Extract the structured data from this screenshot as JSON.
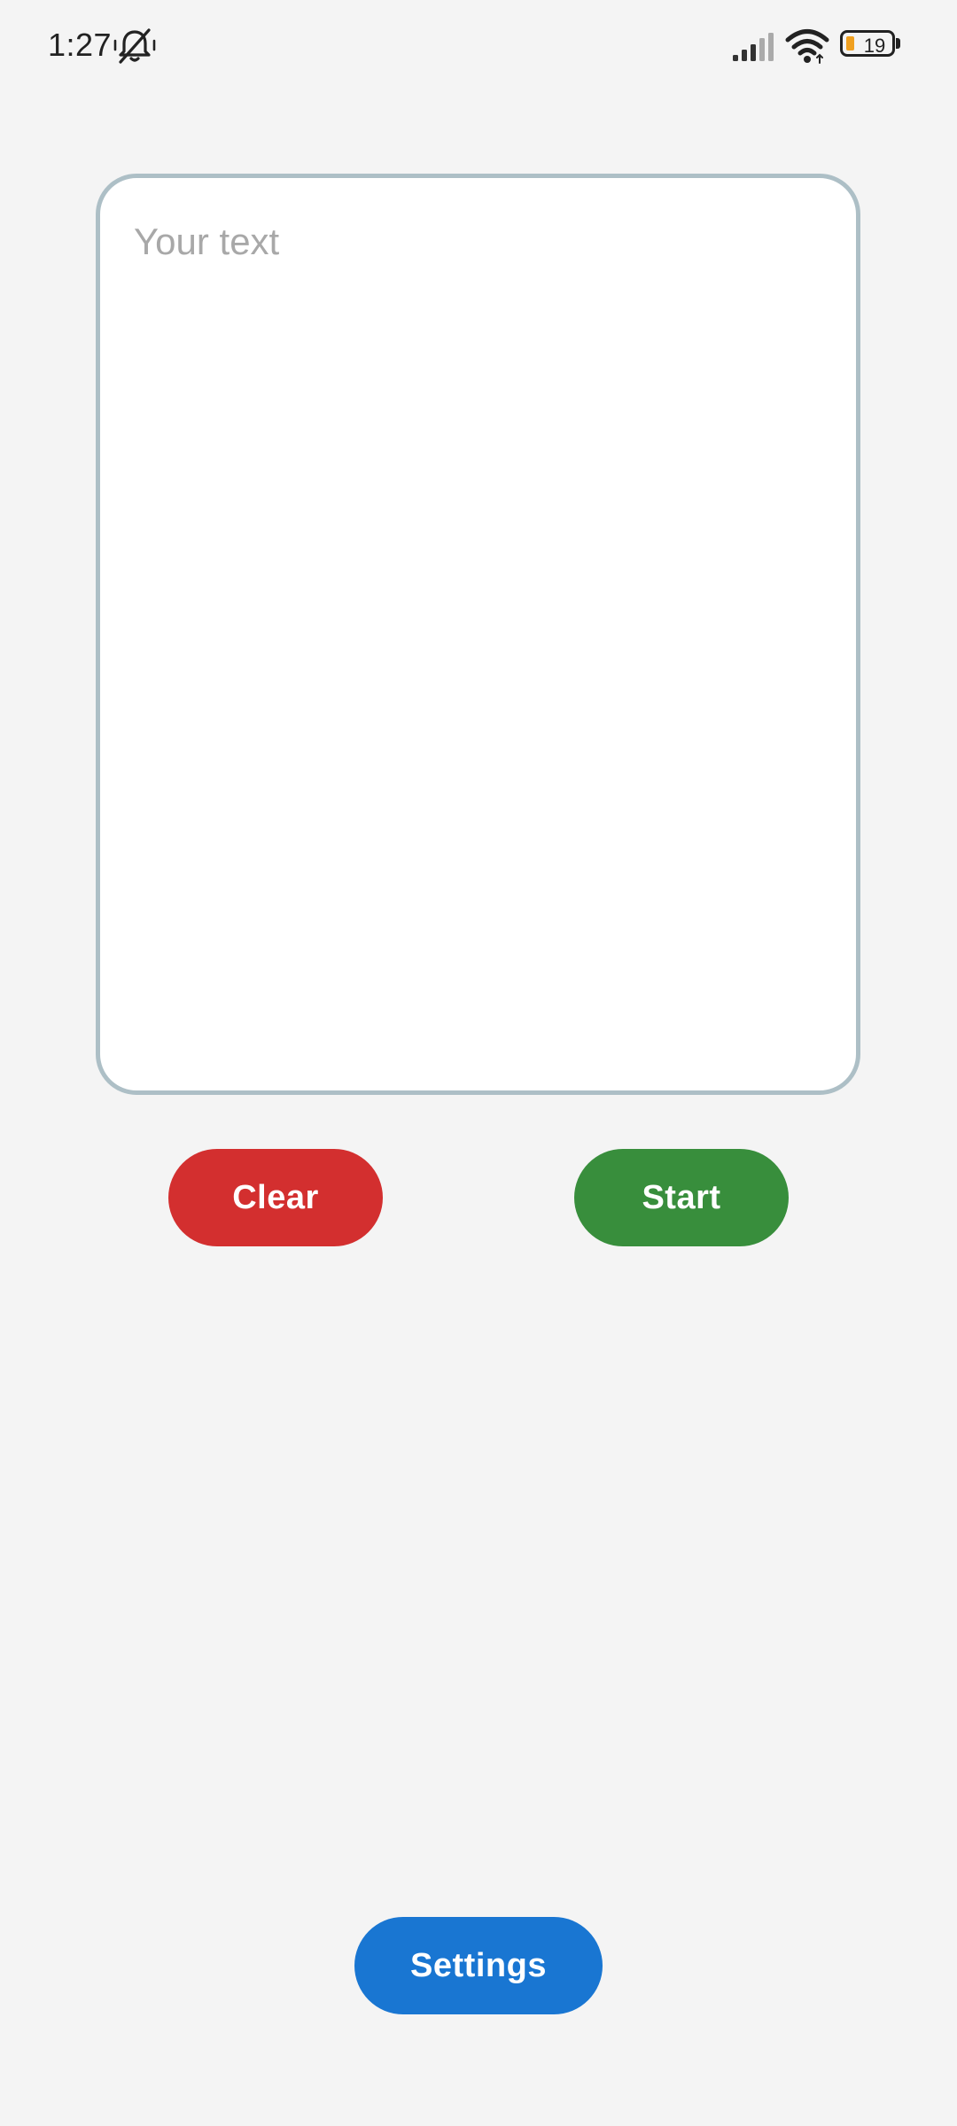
{
  "status_bar": {
    "time": "1:27",
    "battery_level": "19",
    "icons": [
      "mute-bell-icon",
      "signal-icon",
      "wifi-icon",
      "battery-icon"
    ]
  },
  "editor": {
    "value": "",
    "placeholder": "Your text"
  },
  "actions": {
    "clear_label": "Clear",
    "start_label": "Start",
    "settings_label": "Settings"
  },
  "colors": {
    "clear": "#d32f2f",
    "start": "#388e3c",
    "settings": "#1976d2",
    "border": "#adbfc6",
    "background": "#f4f4f4"
  }
}
